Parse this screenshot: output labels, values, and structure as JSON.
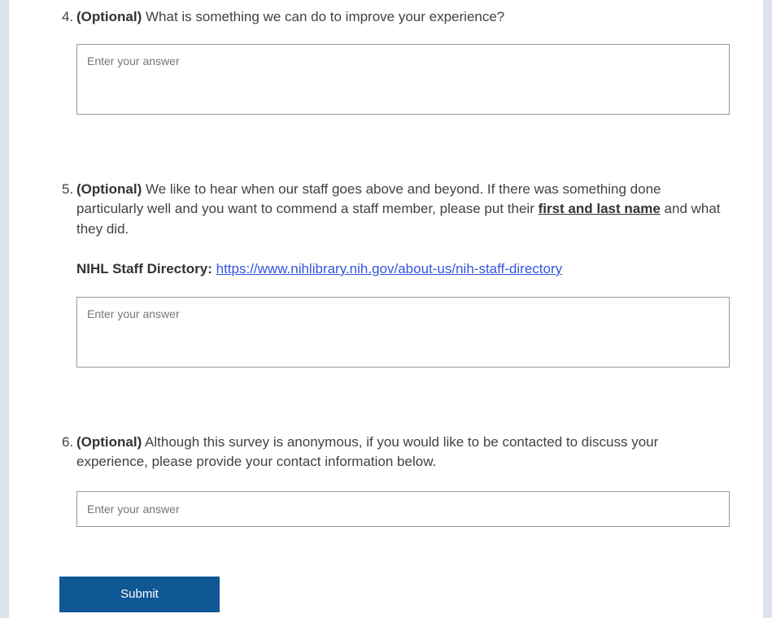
{
  "page": {
    "background_color": "#dde3ed",
    "card_color": "#ffffff"
  },
  "colors": {
    "question_text": "#424242",
    "bold_text": "#333333",
    "placeholder": "#767676",
    "input_border": "#9a9a9a",
    "link": "#3454dd",
    "submit_background": "#0f5795",
    "submit_text": "#ffffff"
  },
  "questions": [
    {
      "number": "4.",
      "optional_label": "(Optional)",
      "text": " What is something we can do to improve your experience?",
      "placeholder": "Enter your answer"
    },
    {
      "number": "5.",
      "optional_label": "(Optional)",
      "text_before": " We like to hear when our staff goes above and beyond. If there was something done particularly well and you want to commend a staff member, please put their ",
      "text_emphasis": "first and last name",
      "text_after": " and what they did.",
      "directory_label": "NIHL Staff Directory: ",
      "directory_link_text": "https://www.nihlibrary.nih.gov/about-us/nih-staff-directory",
      "placeholder": "Enter your answer"
    },
    {
      "number": "6.",
      "optional_label": "(Optional)",
      "text": " Although this survey is anonymous, if you would like to be contacted to discuss your experience, please provide your contact information below.",
      "placeholder": "Enter your answer"
    }
  ],
  "submit_button": {
    "label": "Submit"
  }
}
